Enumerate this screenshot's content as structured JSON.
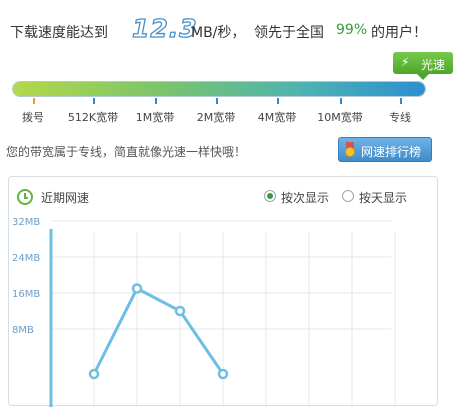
{
  "headline": {
    "prefix": "下载速度能达到",
    "speed": "12.3",
    "unit": "MB/秒，",
    "lead": "领先于全国",
    "percent": "99%",
    "suffix": "的用户！"
  },
  "speed_tag": {
    "icon": "lightning-icon",
    "label": "光速"
  },
  "bandwidth_scale": {
    "fill_fraction": 1.0,
    "labels": [
      "拨号",
      "512K宽带",
      "1M宽带",
      "2M宽带",
      "4M宽带",
      "10M宽带",
      "专线"
    ]
  },
  "info_text": "您的带宽属于专线，简直就像光速一样快哦！",
  "ranking_button": {
    "icon": "medal-icon",
    "label": "网速排行榜"
  },
  "recent_panel": {
    "title": "近期网速",
    "options": [
      {
        "label": "按次显示",
        "selected": true
      },
      {
        "label": "按天显示",
        "selected": false
      }
    ]
  },
  "chart_data": {
    "type": "line",
    "yticks": [
      "8MB",
      "16MB",
      "24MB",
      "32MB"
    ],
    "ylim": [
      0,
      36
    ],
    "x": [
      1,
      2,
      3,
      4,
      5,
      6,
      7,
      8
    ],
    "values": [
      null,
      -2,
      17,
      12,
      -2,
      null,
      null,
      null
    ],
    "grid": true,
    "colors": {
      "line": "#6cbfe3",
      "point": "#6cbfe3",
      "axis": "#6cbfe3",
      "grid": "#e3e8ec"
    }
  }
}
